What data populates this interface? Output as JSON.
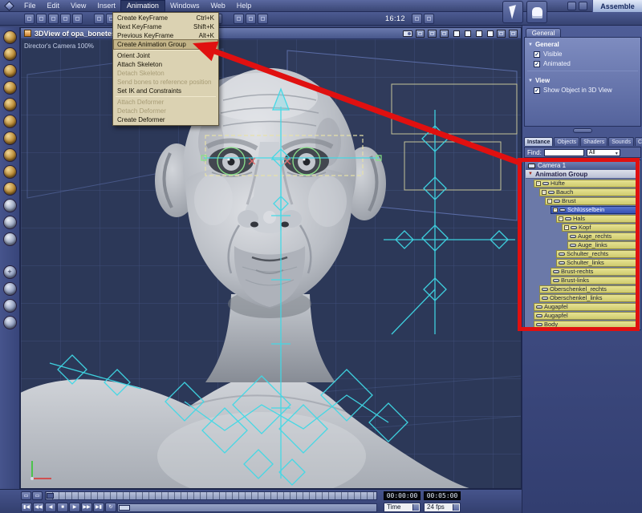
{
  "app": {
    "rooms_label": "Assemble",
    "clock": "16:12"
  },
  "menubar": {
    "items": [
      "File",
      "Edit",
      "View",
      "Insert",
      "Animation",
      "Windows",
      "Web",
      "Help"
    ],
    "open_item": "Animation"
  },
  "animation_menu": {
    "items": [
      {
        "label": "Create KeyFrame",
        "shortcut": "Ctrl+K",
        "state": "normal"
      },
      {
        "label": "Next KeyFrame",
        "shortcut": "Shift+K",
        "state": "normal"
      },
      {
        "label": "Previous KeyFrame",
        "shortcut": "Alt+K",
        "state": "normal"
      },
      {
        "label": "Create Animation Group",
        "shortcut": "",
        "state": "highlighted"
      },
      {
        "label": "Orient Joint",
        "shortcut": "",
        "state": "normal"
      },
      {
        "label": "Attach Skeleton",
        "shortcut": "",
        "state": "normal"
      },
      {
        "label": "Detach Skeleton",
        "shortcut": "",
        "state": "disabled"
      },
      {
        "label": "Send bones to reference position",
        "shortcut": "",
        "state": "disabled"
      },
      {
        "label": "Set IK and Constraints",
        "shortcut": "",
        "state": "normal"
      },
      {
        "label": "Attach Deformer",
        "shortcut": "",
        "state": "disabled"
      },
      {
        "label": "Detach Deformer",
        "shortcut": "",
        "state": "disabled"
      },
      {
        "label": "Create Deformer",
        "shortcut": "",
        "state": "normal"
      }
    ]
  },
  "viewport": {
    "title": "3DView of opa_bonetest",
    "camera_label": "Director's Camera 100%"
  },
  "properties": {
    "tab": "General",
    "section_general": "General",
    "check_visible": "Visible",
    "check_animated": "Animated",
    "section_view": "View",
    "check_show_object": "Show Object in 3D View"
  },
  "browser": {
    "tabs": [
      "Instance",
      "Objects",
      "Shaders",
      "Sounds",
      "Clips"
    ],
    "active_tab": "Instance",
    "find_label": "Find:",
    "find_value": "",
    "filter_value": "All",
    "header": "Camera 1",
    "group_row": "Animation Group",
    "tree": [
      {
        "label": "Hüfte",
        "indent": 1
      },
      {
        "label": "Bauch",
        "indent": 2
      },
      {
        "label": "Brust",
        "indent": 3
      },
      {
        "label": "Schlüsselbein",
        "indent": 4,
        "selected": true
      },
      {
        "label": "Hals",
        "indent": 5
      },
      {
        "label": "Kopf",
        "indent": 6
      },
      {
        "label": "Auge_rechts",
        "indent": 7
      },
      {
        "label": "Auge_links",
        "indent": 7
      },
      {
        "label": "Schulter_rechts",
        "indent": 5
      },
      {
        "label": "Schulter_links",
        "indent": 5
      },
      {
        "label": "Brust-rechts",
        "indent": 4
      },
      {
        "label": "Brust-links",
        "indent": 4
      },
      {
        "label": "Oberschenkel_rechts",
        "indent": 2
      },
      {
        "label": "Oberschenkel_links",
        "indent": 2
      },
      {
        "label": "Augapfel",
        "indent": 1
      },
      {
        "label": "Augapfel",
        "indent": 1
      },
      {
        "label": "Body",
        "indent": 1
      }
    ]
  },
  "timeline": {
    "time_current": "00:00:00",
    "time_end": "00:05:00",
    "mode": "Time",
    "fps": "24 fps"
  },
  "colors": {
    "accent_red": "#e01010",
    "tree_yellow": "#dcd87c",
    "selection_blue": "#3b5bc0"
  }
}
